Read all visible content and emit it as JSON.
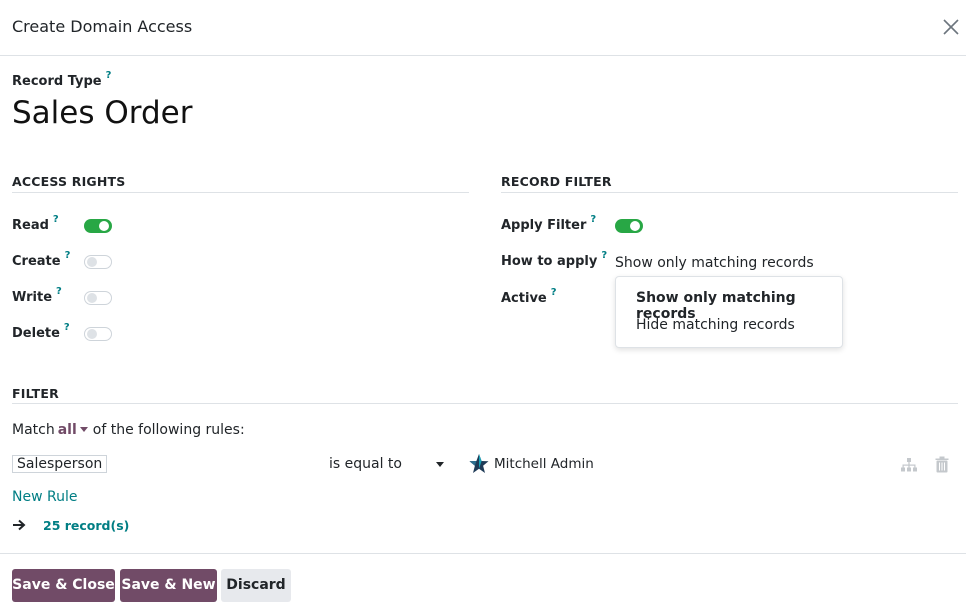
{
  "dialog": {
    "title": "Create Domain Access",
    "close_icon": "close-icon"
  },
  "record_type": {
    "label": "Record Type",
    "help": "?",
    "value": "Sales Order"
  },
  "access_rights": {
    "title": "ACCESS RIGHTS",
    "rows": [
      {
        "label": "Read",
        "help": "?",
        "enabled": true
      },
      {
        "label": "Create",
        "help": "?",
        "enabled": false
      },
      {
        "label": "Write",
        "help": "?",
        "enabled": false
      },
      {
        "label": "Delete",
        "help": "?",
        "enabled": false
      }
    ]
  },
  "record_filter": {
    "title": "RECORD FILTER",
    "apply_filter": {
      "label": "Apply Filter",
      "help": "?",
      "enabled": true
    },
    "how_to_apply": {
      "label": "How to apply",
      "help": "?",
      "value": "Show only matching records"
    },
    "active": {
      "label": "Active",
      "help": "?"
    },
    "dropdown_options": [
      "Show only matching records",
      "Hide matching records"
    ]
  },
  "filter": {
    "title": "FILTER",
    "match_prefix": "Match",
    "match_mode": "all",
    "match_suffix": "of the following rules:",
    "rule": {
      "field": "Salesperson",
      "operator": "is equal to",
      "value": "Mitchell Admin"
    },
    "new_rule": "New Rule",
    "records": "25 record(s)"
  },
  "footer": {
    "save_close": "Save & Close",
    "save_new": "Save & New",
    "discard": "Discard"
  },
  "colors": {
    "primary": "#714b67",
    "accent": "#017e84",
    "toggle_on": "#28a745"
  }
}
